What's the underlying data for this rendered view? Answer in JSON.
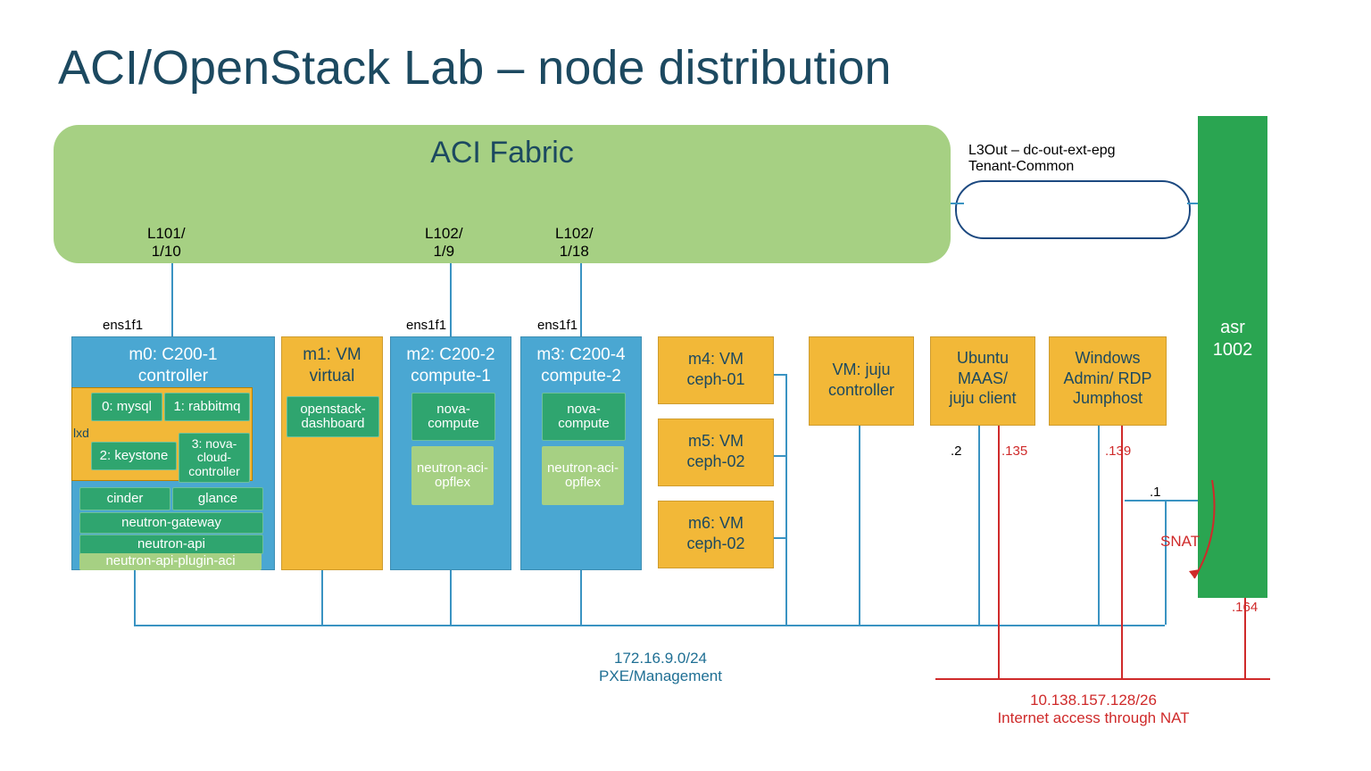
{
  "title": "ACI/OpenStack Lab – node distribution",
  "fabric": {
    "title": "ACI Fabric"
  },
  "ports": {
    "p1": "L101/\n1/10",
    "p2": "L102/\n1/9",
    "p3": "L102/\n1/18"
  },
  "l3out": "L3Out – dc-out-ext-epg\nTenant-Common",
  "iface": {
    "m0": "ens1f1",
    "m2": "ens1f1",
    "m3": "ens1f1"
  },
  "asr": "asr\n1002",
  "nodes": {
    "m0": {
      "title": "m0: C200-1\ncontroller"
    },
    "m1": {
      "title": "m1: VM\nvirtual",
      "dash": "openstack-dashboard"
    },
    "m2": {
      "title": "m2: C200-2\ncompute-1"
    },
    "m3": {
      "title": "m3: C200-4\ncompute-2"
    },
    "m4": {
      "title": "m4: VM\nceph-01"
    },
    "m5": {
      "title": "m5: VM\nceph-02"
    },
    "m6": {
      "title": "m6: VM\nceph-02"
    },
    "juju": {
      "title": "VM: juju\ncontroller"
    },
    "maas": {
      "title": "Ubuntu\nMAAS/\njuju client"
    },
    "winrdp": {
      "title": "Windows\nAdmin/ RDP\nJumphost"
    }
  },
  "m0_services": {
    "mysql": "0: mysql",
    "rabbit": "1: rabbitmq",
    "keystone": "2: keystone",
    "nova_cc": "3: nova-cloud-controller",
    "cinder": "cinder",
    "glance": "glance",
    "ngw": "neutron-gateway",
    "napi": "neutron-api",
    "naci": "neutron-api-plugin-aci",
    "lxd": "lxd"
  },
  "compute_services": {
    "nova": "nova-compute",
    "opflex": "neutron-aci-opflex"
  },
  "ips": {
    "maas": ".2",
    "maas_red": ".135",
    "win_red": ".139",
    "gw": ".1",
    "asr_red": ".164"
  },
  "snat": "SNAT",
  "networks": {
    "mgmt": "172.16.9.0/24\nPXE/Management",
    "nat": "10.138.157.128/26\nInternet access through NAT"
  }
}
